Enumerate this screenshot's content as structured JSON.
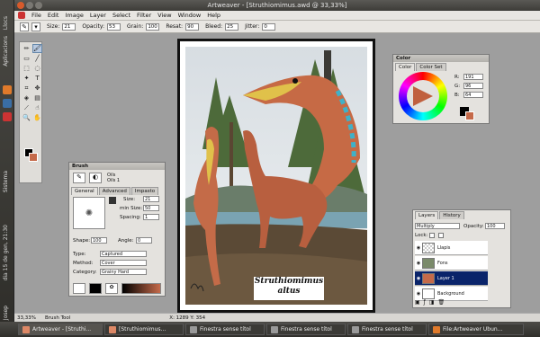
{
  "os": {
    "left_labels": [
      "Llocs",
      "Aplicacions",
      "Sistema"
    ],
    "clock": "dia 15 de gen, 21:30",
    "user": "Josep"
  },
  "window": {
    "title": "Artweaver - [Struthiomimus.awd @ 33,33%]"
  },
  "menu": [
    "File",
    "Edit",
    "Image",
    "Layer",
    "Select",
    "Filter",
    "View",
    "Window",
    "Help"
  ],
  "options": {
    "size_label": "Size:",
    "size_value": "21",
    "opacity_label": "Opacity:",
    "opacity_value": "53",
    "grain_label": "Grain:",
    "grain_value": "100",
    "resat_label": "Resat:",
    "resat_value": "90",
    "bleed_label": "Bleed:",
    "bleed_value": "25",
    "jitter_label": "Jitter:",
    "jitter_value": "0"
  },
  "tools": [
    "pencil",
    "brush",
    "eraser",
    "line",
    "rect-select",
    "lasso",
    "magic-wand",
    "text",
    "crop",
    "move",
    "fill",
    "gradient",
    "eyedropper",
    "smudge",
    "zoom",
    "hand"
  ],
  "colors": {
    "foreground": "#000000",
    "background": "#c56a4a",
    "accent": "#0a246a"
  },
  "canvas": {
    "caption_title": "Struthiomimus",
    "caption_sub": "altus"
  },
  "color_palette": {
    "title": "Color",
    "tabs": [
      "Color",
      "Color Set"
    ],
    "r_label": "R:",
    "r_value": "191",
    "g_label": "G:",
    "g_value": "96",
    "b_label": "B:",
    "b_value": "64"
  },
  "brush_palette": {
    "title": "Brush",
    "category_a": "Oils",
    "variant_a": "Oils 1",
    "tabs": [
      "General",
      "Advanced",
      "Impasto"
    ],
    "size_label": "Size:",
    "size_value": "21",
    "min_size_label": "min Size:",
    "min_size_value": "50",
    "spacing_label": "Spacing:",
    "spacing_value": "1",
    "shape_label": "Shape:",
    "shape_value": "100",
    "angle_label": "Angle:",
    "angle_value": "0",
    "type_label": "Type:",
    "type_value": "Captured",
    "method_label": "Method:",
    "method_value": "Cover",
    "category_label": "Category:",
    "category_value": "Grainy Hard",
    "captured": "Captured"
  },
  "layers_palette": {
    "tabs": [
      "Layers",
      "History"
    ],
    "mode": "Multiply",
    "opacity_label": "Opacity:",
    "opacity_value": "100",
    "lock_label": "Lock:",
    "layers": [
      {
        "name": "Llapis"
      },
      {
        "name": "Fons"
      },
      {
        "name": "Layer 1"
      },
      {
        "name": "Background"
      }
    ]
  },
  "status": {
    "zoom": "33,33%",
    "tool": "Brush Tool",
    "coords": "X: 1289  Y: 354"
  },
  "taskbar": [
    {
      "label": "Artweaver - [Struthi..."
    },
    {
      "label": "[Struthiomimus..."
    },
    {
      "label": "Finestra sense títol"
    },
    {
      "label": "Finestra sense títol"
    },
    {
      "label": "Finestra sense títol"
    },
    {
      "label": "File:Artweaver Ubun..."
    }
  ]
}
